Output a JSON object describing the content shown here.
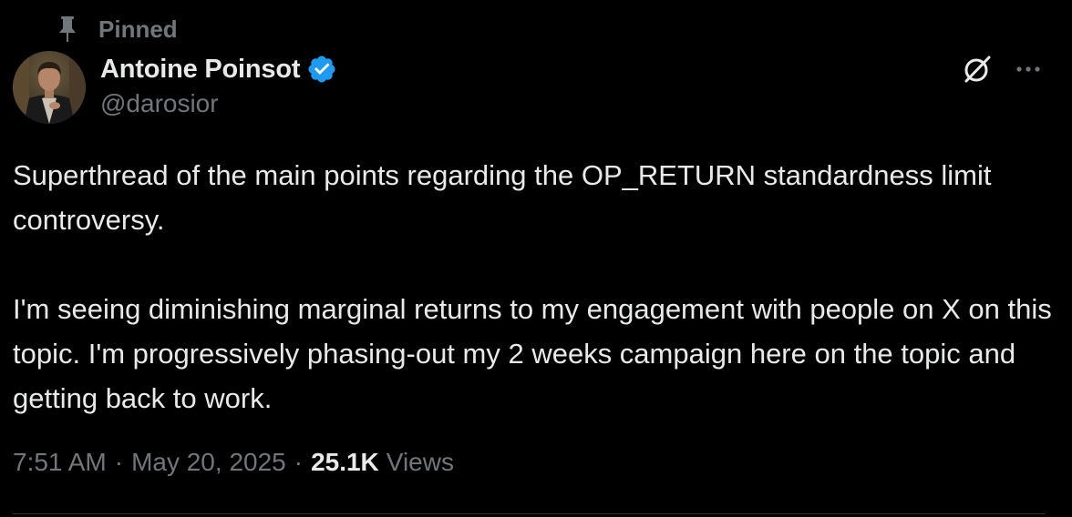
{
  "pinned": {
    "label": "Pinned",
    "icon": "pin-icon"
  },
  "author": {
    "display_name": "Antoine Poinsot",
    "handle": "@darosior",
    "verified": true,
    "verified_color": "#1d9bf0"
  },
  "header_actions": {
    "grok_icon": "grok-icon",
    "more_icon": "more-icon"
  },
  "tweet": {
    "paragraphs": [
      "Superthread of the main points regarding the OP_RETURN standardness limit controversy.",
      "I'm seeing diminishing marginal returns to my engagement with people on X on this topic. I'm progressively phasing-out my 2 weeks campaign here on the topic and getting back to work."
    ]
  },
  "meta": {
    "time": "7:51 AM",
    "separator": "·",
    "date": "May 20, 2025",
    "views_count": "25.1K",
    "views_label": "Views"
  },
  "colors": {
    "background": "#000000",
    "primary_text": "#e7e9ea",
    "secondary_text": "#71767b",
    "divider": "#2f3336"
  }
}
